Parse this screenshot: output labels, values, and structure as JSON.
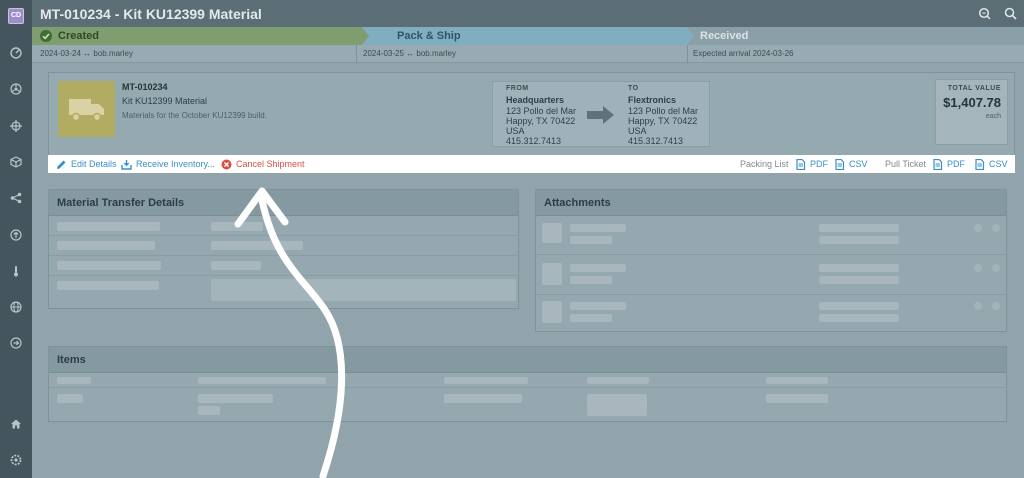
{
  "user": {
    "initials": "CD"
  },
  "sidebar": {
    "icons": [
      "dashboard-icon",
      "biohazard-icon",
      "crosshair-icon",
      "box-icon",
      "share-icon",
      "upload-icon",
      "thermometer-icon",
      "globe-icon",
      "arrow-right-circle-icon",
      "home-icon",
      "settings-icon"
    ]
  },
  "header": {
    "title": "MT-010234 - Kit KU12399 Material"
  },
  "steps": [
    {
      "label": "Created",
      "meta": "2024-03-24 ↔ bob.marley"
    },
    {
      "label": "Pack & Ship",
      "meta": "2024-03-25 ↔ bob.marley"
    },
    {
      "label": "Received",
      "meta": "Expected arrival 2024-03-26"
    }
  ],
  "summary": {
    "id": "MT-010234",
    "name": "Kit KU12399 Material",
    "description": "Materials for the October KU12399 build.",
    "from": {
      "label": "FROM",
      "name": "Headquarters",
      "line1": "123 Pollo del Mar",
      "line2": "Happy, TX 70422",
      "country": "USA",
      "phone": "415.312.7413"
    },
    "to": {
      "label": "TO",
      "name": "Flextronics",
      "line1": "123 Pollo del Mar",
      "line2": "Happy, TX 70422",
      "country": "USA",
      "phone": "415.312.7413"
    },
    "total": {
      "label": "TOTAL VALUE",
      "value": "$1,407.78",
      "unit": "each"
    }
  },
  "actions": {
    "edit": "Edit Details",
    "receive": "Receive Inventory...",
    "cancel": "Cancel Shipment",
    "packing_list": "Packing List",
    "pull_ticket": "Pull Ticket",
    "pdf": "PDF",
    "csv": "CSV"
  },
  "panels": {
    "details": "Material Transfer Details",
    "attachments": "Attachments",
    "items": "Items"
  },
  "colors": {
    "accent": "#3a8fc9",
    "danger": "#d94f44",
    "created": "#7f9e6f",
    "active": "#80aec0"
  }
}
